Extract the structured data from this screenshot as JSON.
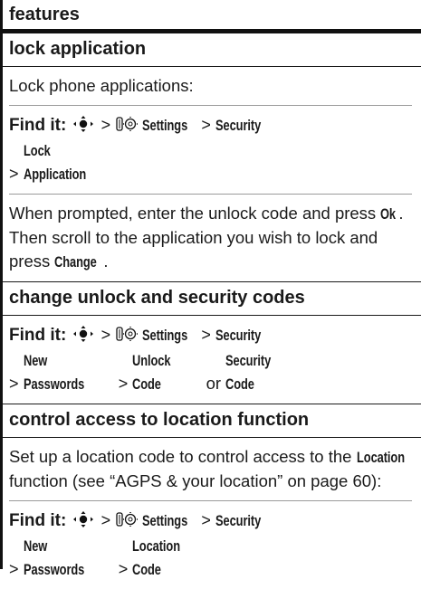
{
  "header": {
    "title": "features"
  },
  "sections": [
    {
      "title": "lock application",
      "intro": "Lock phone applications:",
      "find_it": {
        "label": "Find it:",
        "path1": "Settings",
        "path2": "Security",
        "path3": "Lock Application"
      },
      "instructions": {
        "t1": "When prompted, enter the unlock code and press",
        "ok": "Ok",
        "t2": ". Then scroll to the application you wish to lock and press",
        "change": "Change",
        "t3": "."
      }
    },
    {
      "title": "change unlock and security codes",
      "find_it": {
        "label": "Find it:",
        "path1": "Settings",
        "path2": "Security",
        "path3": "New Passwords",
        "path4": "Unlock Code",
        "or": "or",
        "path5": "Security Code"
      }
    },
    {
      "title": "control access to location function",
      "intro": {
        "t1": "Set up a location code to control access to the",
        "location": "Location",
        "t2": "function (see “AGPS & your location” on page 60):"
      },
      "find_it": {
        "label": "Find it:",
        "path1": "Settings",
        "path2": "Security",
        "path3": "New Passwords",
        "path4": "Location Code"
      }
    }
  ],
  "icons": {
    "nav": "nav-key-icon",
    "settings": "settings-icon"
  }
}
